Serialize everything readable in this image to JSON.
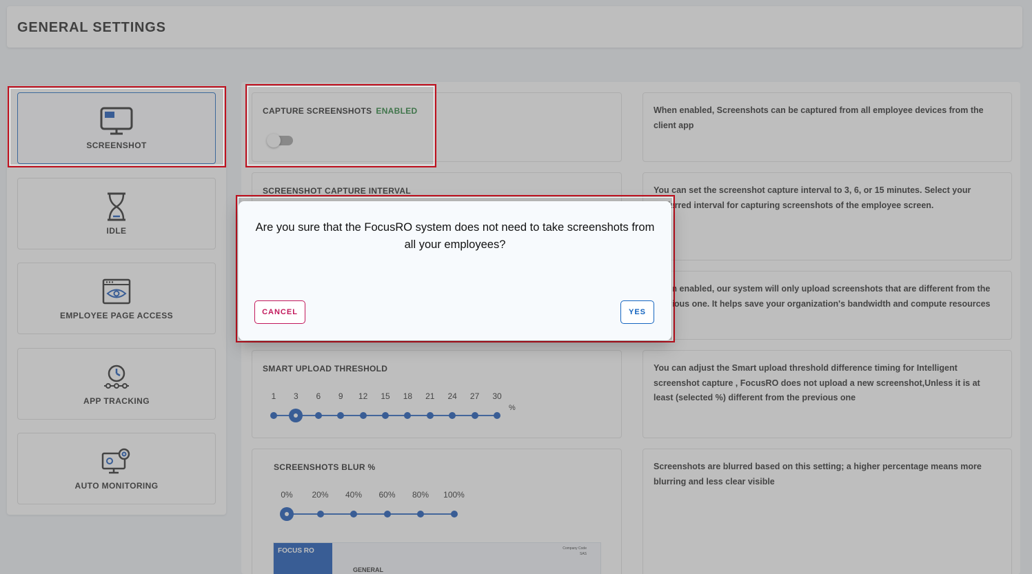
{
  "header": {
    "title": "GENERAL SETTINGS"
  },
  "sidebar": {
    "items": [
      {
        "label": "SCREENSHOT",
        "icon": "monitor-icon",
        "active": true
      },
      {
        "label": "IDLE",
        "icon": "hourglass-icon",
        "active": false
      },
      {
        "label": "EMPLOYEE PAGE ACCESS",
        "icon": "eye-browser-icon",
        "active": false
      },
      {
        "label": "APP TRACKING",
        "icon": "clock-tracking-icon",
        "active": false
      },
      {
        "label": "AUTO MONITORING",
        "icon": "monitor-gear-icon",
        "active": false
      }
    ]
  },
  "settings": {
    "capture": {
      "title": "CAPTURE SCREENSHOTS",
      "status": "ENABLED",
      "toggle_on": false,
      "description": "When enabled, Screenshots can be captured from all employee devices from the client app"
    },
    "interval": {
      "title": "SCREENSHOT CAPTURE INTERVAL",
      "description": "You can set the screenshot capture interval to 3, 6, or 15 minutes. Select your preferred interval for capturing screenshots of the employee screen."
    },
    "smart_upload": {
      "description": "When enabled, our system will only upload screenshots that are different from the previous one. It helps save your organization's bandwidth and compute resources"
    },
    "threshold": {
      "title": "SMART UPLOAD THRESHOLD",
      "options": [
        "1",
        "3",
        "6",
        "9",
        "12",
        "15",
        "18",
        "21",
        "24",
        "27",
        "30"
      ],
      "unit": "%",
      "selected_index": 1,
      "description": "You can adjust the Smart upload threshold difference timing for Intelligent screenshot capture , FocusRO does not upload a new screenshot,Unless it is at least (selected %) different from the previous one"
    },
    "blur": {
      "title": "SCREENSHOTS BLUR %",
      "options": [
        "0%",
        "20%",
        "40%",
        "60%",
        "80%",
        "100%"
      ],
      "selected_index": 0,
      "description": "Screenshots are blurred based on this setting; a higher percentage means more blurring and less clear visible",
      "preview": {
        "brand": "FOCUS RO",
        "section": "GENERAL",
        "company_label": "Company Code",
        "company_code": "SAS"
      }
    }
  },
  "modal": {
    "message": "Are you sure that the FocusRO system does not need to take screenshots from all your employees?",
    "cancel_label": "CANCEL",
    "yes_label": "YES"
  },
  "colors": {
    "accent": "#0d4fb5",
    "enabled": "#1b7a2e",
    "cancel": "#c2185b",
    "highlight": "#c0111f"
  }
}
